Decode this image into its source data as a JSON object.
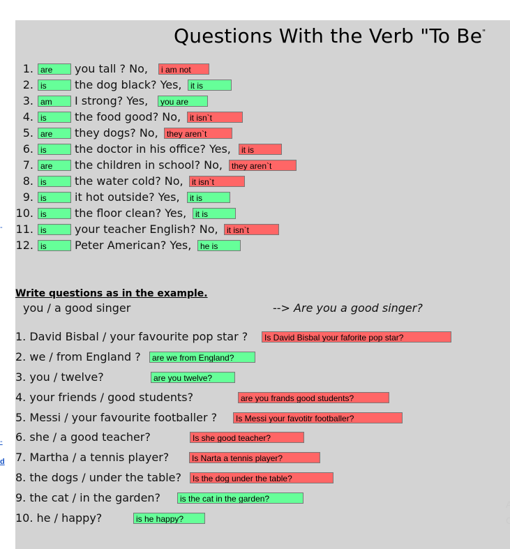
{
  "title": "Questions With the Verb \"To Be",
  "title_quote": "\"",
  "part1": [
    {
      "num": "1.",
      "verb": "are",
      "verb_ok": true,
      "text": "you tall ?  No,",
      "answer": "i am not",
      "answer_ok": false
    },
    {
      "num": "2.",
      "verb": "is",
      "verb_ok": true,
      "text": "the dog black? Yes,",
      "answer": "it is",
      "answer_ok": true
    },
    {
      "num": "3.",
      "verb": "am",
      "verb_ok": true,
      "text": "I strong? Yes,",
      "answer": "you are",
      "answer_ok": true
    },
    {
      "num": "4.",
      "verb": "is",
      "verb_ok": true,
      "text": "the food good? No,",
      "answer": "it  isn`t",
      "answer_ok": false
    },
    {
      "num": "5.",
      "verb": "are",
      "verb_ok": true,
      "text": "they dogs? No,",
      "answer": "they aren`t",
      "answer_ok": false
    },
    {
      "num": "6.",
      "verb": "is",
      "verb_ok": true,
      "text": "the doctor in his office? Yes,",
      "answer": "it is",
      "answer_ok": false
    },
    {
      "num": "7.",
      "verb": "are",
      "verb_ok": true,
      "text": "the children in school? No,",
      "answer": "they aren`t",
      "answer_ok": false
    },
    {
      "num": "8.",
      "verb": "is",
      "verb_ok": true,
      "text": "the water cold? No,",
      "answer": "it isn`t",
      "answer_ok": false
    },
    {
      "num": "9.",
      "verb": "is",
      "verb_ok": true,
      "text": "it hot outside? Yes,",
      "answer": "it is",
      "answer_ok": true
    },
    {
      "num": "10.",
      "verb": "is",
      "verb_ok": true,
      "text": "the floor clean? Yes,",
      "answer": "it is",
      "answer_ok": true
    },
    {
      "num": "11.",
      "verb": "is",
      "verb_ok": true,
      "text": "your teacher English? No,",
      "answer": "it isn`t",
      "answer_ok": false
    },
    {
      "num": "12.",
      "verb": "is",
      "verb_ok": true,
      "text": "Peter American? Yes,",
      "answer": "he is",
      "answer_ok": true
    }
  ],
  "instructions": "Write questions as in the example.",
  "example": {
    "prompt": "you / a good singer",
    "arrow": "-->",
    "answer": "Are you a good singer?"
  },
  "part2": [
    {
      "text": "1. David Bisbal / your favourite pop star ?",
      "answer": "Is David Bisbal your faforite pop star?",
      "ok": false
    },
    {
      "text": "2. we / from England ?",
      "answer": "are we from England?",
      "ok": true
    },
    {
      "text": "3. you / twelve?",
      "answer": "are you twelve?",
      "ok": true
    },
    {
      "text": "4. your friends / good students?",
      "answer": "are you frands good students?",
      "ok": false
    },
    {
      "text": "5. Messi / your favourite footballer ?",
      "answer": "Is Messi your favotitr footballer?",
      "ok": false
    },
    {
      "text": "6. she / a good teacher?",
      "answer": "Is she good teacher?",
      "ok": false
    },
    {
      "text": "7. Martha / a tennis player?",
      "answer": "Is Narta a tennis player?",
      "ok": false
    },
    {
      "text": "8. the dogs / under the table?",
      "answer": "Is the dog under the table?",
      "ok": false
    },
    {
      "text": "9. the cat / in the garden?",
      "answer": "is the cat in the garden?",
      "ok": true
    },
    {
      "text": "10. he / happy?",
      "answer": "is he happy?",
      "ok": true
    }
  ],
  "colors": {
    "correct": "#66ff99",
    "incorrect": "#ff6666",
    "sheet": "#d3d3d3"
  }
}
